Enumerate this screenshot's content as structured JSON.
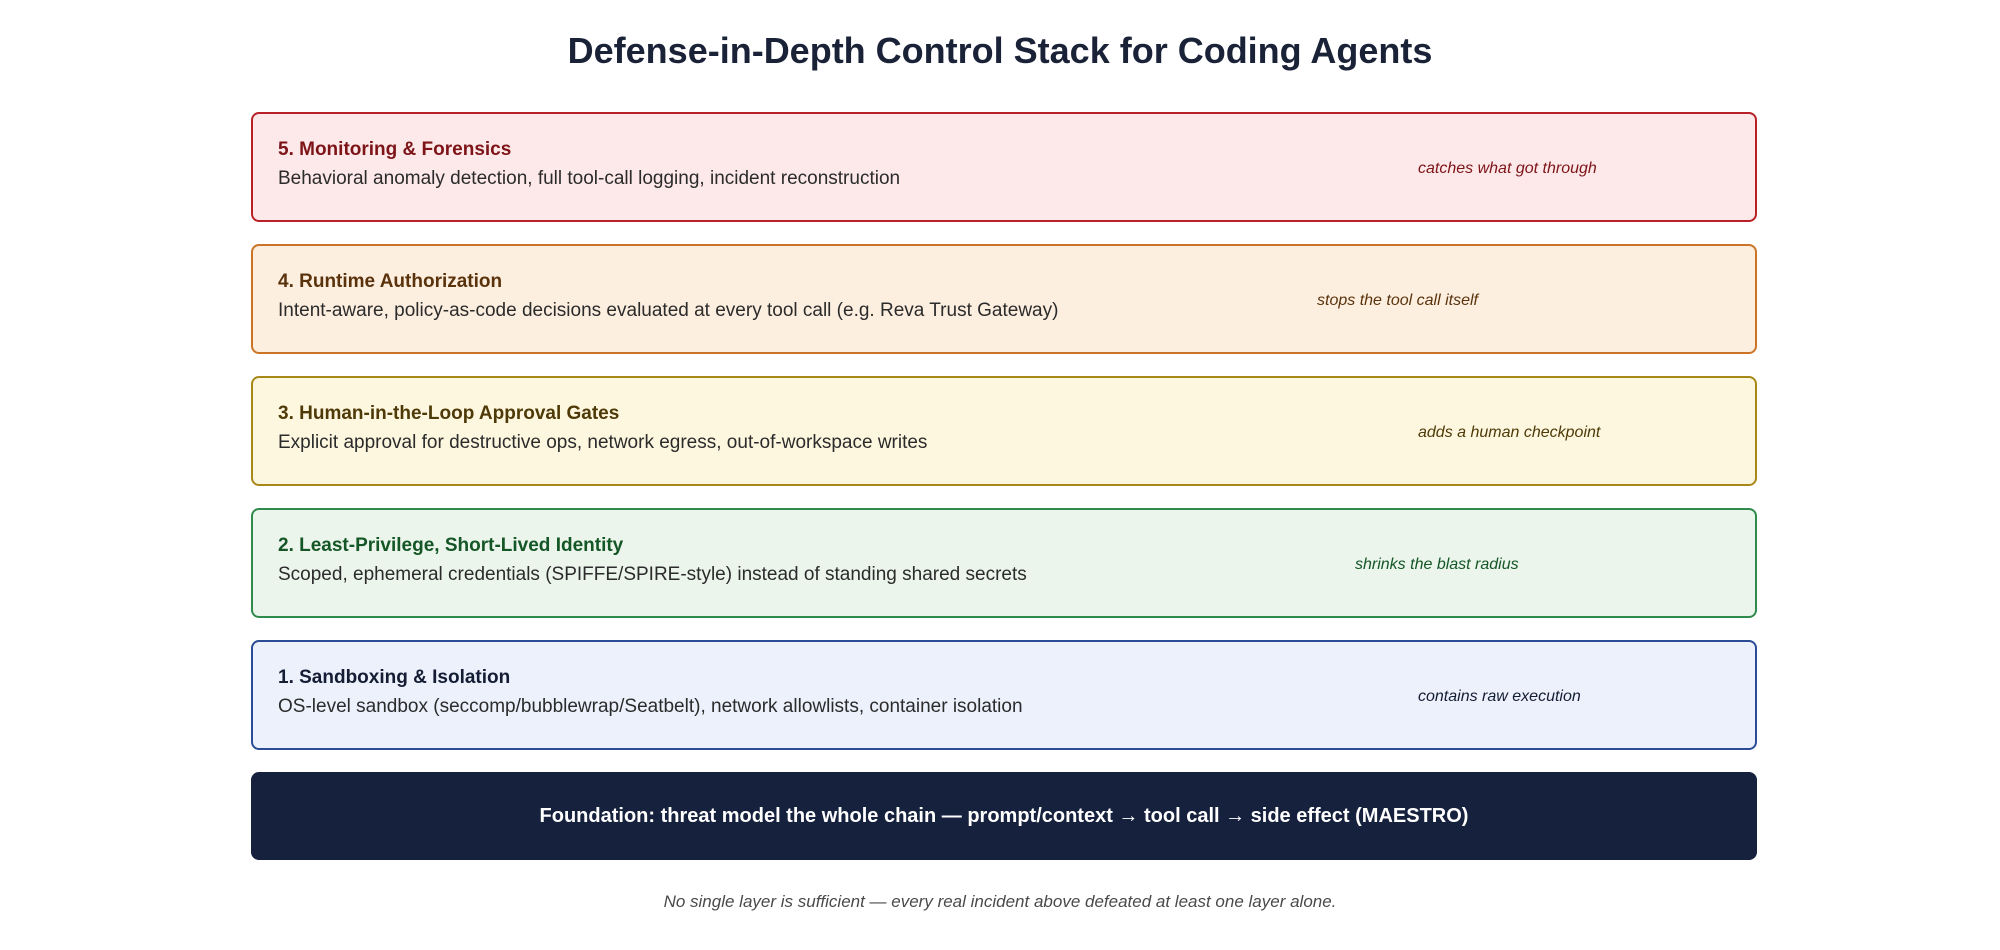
{
  "title": "Defense-in-Depth Control Stack for Coding Agents",
  "layers": [
    {
      "name": "5. Monitoring & Forensics",
      "description": "Behavioral anomaly detection, full tool-call logging, incident reconstruction",
      "note": "catches what got through",
      "border_color": "#b92126",
      "fill_color": "#fde8ea"
    },
    {
      "name": "4. Runtime Authorization",
      "description": "Intent-aware, policy-as-code decisions evaluated at every tool call (e.g. Reva Trust Gateway)",
      "note": "stops the tool call itself",
      "border_color": "#cc7426",
      "fill_color": "#fdefe0"
    },
    {
      "name": "3. Human-in-the-Loop Approval Gates",
      "description": "Explicit approval for destructive ops, network egress, out-of-workspace writes",
      "note": "adds a human checkpoint",
      "border_color": "#a88918",
      "fill_color": "#fef7e0"
    },
    {
      "name": "2. Least-Privilege, Short-Lived Identity",
      "description": "Scoped, ephemeral credentials (SPIFFE/SPIRE-style) instead of standing shared secrets",
      "note": "shrinks the blast radius",
      "border_color": "#2e8b4b",
      "fill_color": "#ebf5ec"
    },
    {
      "name": "1. Sandboxing & Isolation",
      "description": "OS-level sandbox (seccomp/bubblewrap/Seatbelt), network allowlists, container isolation",
      "note": "contains raw execution",
      "border_color": "#2c4c96",
      "fill_color": "#ecf1fc"
    }
  ],
  "foundation": {
    "text": "Foundation: threat model the whole chain — prompt/context → tool call → side effect (MAESTRO)",
    "fill_color": "#16213d"
  },
  "footnote": "No single layer is sufficient — every real incident above defeated at least one layer alone."
}
